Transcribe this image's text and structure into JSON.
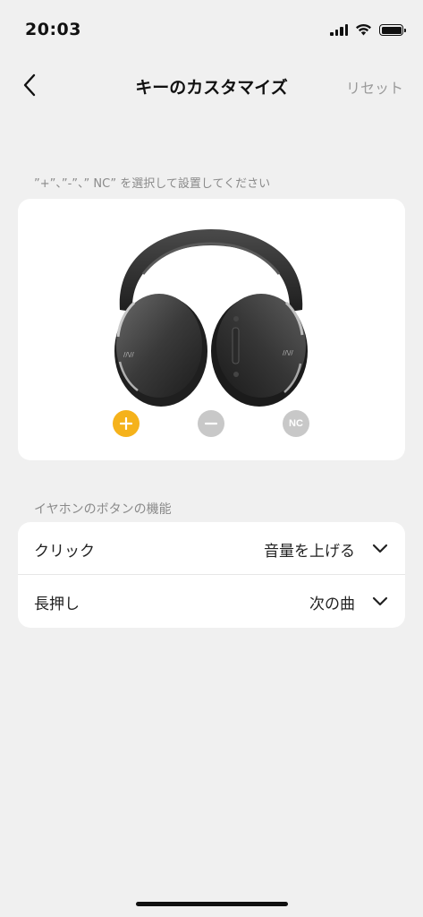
{
  "status_bar": {
    "time": "20:03",
    "icons": [
      "signal-icon",
      "wifi-icon",
      "battery-icon"
    ]
  },
  "nav": {
    "back_icon": "chevron-left-icon",
    "title": "キーのカスタマイズ",
    "reset_label": "リセット"
  },
  "hint": "”+”、”-”、” NC” を選択して設置してください",
  "headphone": {
    "image": "headphones-image",
    "keys": [
      {
        "name": "plus",
        "label": "+",
        "selected": true
      },
      {
        "name": "minus",
        "label": "−",
        "selected": false
      },
      {
        "name": "nc",
        "label": "NC",
        "selected": false
      }
    ]
  },
  "button_functions": {
    "section_label": "イヤホンのボタンの機能",
    "rows": [
      {
        "label": "クリック",
        "value": "音量を上げる"
      },
      {
        "label": "長押し",
        "value": "次の曲"
      }
    ]
  },
  "colors": {
    "accent": "#f5b21b",
    "inactive": "#c8c8c8",
    "background": "#f0f0f0",
    "card": "#ffffff"
  }
}
